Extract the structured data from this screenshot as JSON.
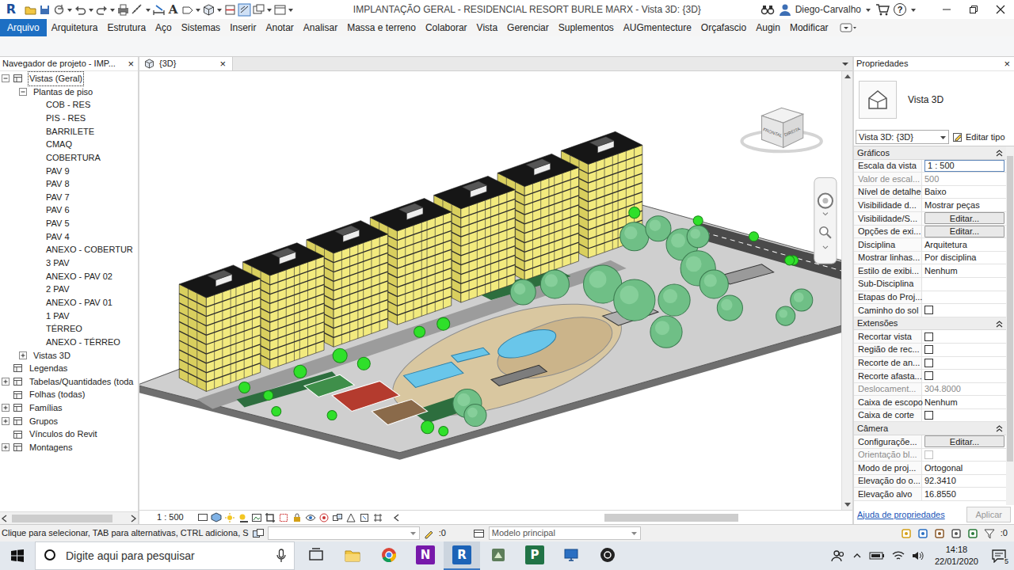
{
  "window": {
    "app_glyph": "R",
    "text_tool_glyph": "A",
    "title": "IMPLANTAÇÃO GERAL - RESIDENCIAL RESORT BURLE MARX - Vista 3D: {3D}",
    "user": "Diego-Carvalho",
    "help": "?"
  },
  "ribbon": {
    "tabs": [
      {
        "label": "Arquivo",
        "kind": "app",
        "selected": false
      },
      {
        "label": "Arquitetura",
        "kind": "tab",
        "selected": false
      },
      {
        "label": "Estrutura",
        "kind": "tab",
        "selected": false
      },
      {
        "label": "Aço",
        "kind": "tab",
        "selected": false
      },
      {
        "label": "Sistemas",
        "kind": "tab",
        "selected": false
      },
      {
        "label": "Inserir",
        "kind": "tab",
        "selected": false
      },
      {
        "label": "Anotar",
        "kind": "tab",
        "selected": false
      },
      {
        "label": "Analisar",
        "kind": "tab",
        "selected": false
      },
      {
        "label": "Massa e terreno",
        "kind": "tab",
        "selected": false
      },
      {
        "label": "Colaborar",
        "kind": "tab",
        "selected": false
      },
      {
        "label": "Vista",
        "kind": "tab",
        "selected": false
      },
      {
        "label": "Gerenciar",
        "kind": "tab",
        "selected": false
      },
      {
        "label": "Suplementos",
        "kind": "tab",
        "selected": false
      },
      {
        "label": "AUGmentecture",
        "kind": "tab",
        "selected": false
      },
      {
        "label": "Orçafascio",
        "kind": "tab",
        "selected": false
      },
      {
        "label": "Augin",
        "kind": "tab",
        "selected": false
      },
      {
        "label": "Modificar",
        "kind": "tab",
        "selected": false
      }
    ]
  },
  "browser": {
    "title": "Navegador de projeto - IMP...",
    "close": "×",
    "items": [
      {
        "label": "Vistas (Geral)",
        "level": 0,
        "has_children": true,
        "expanded": true,
        "selected": true
      },
      {
        "label": "Plantas de piso",
        "level": 1,
        "has_children": true,
        "expanded": true,
        "selected": false
      },
      {
        "label": "COB - RES",
        "level": 2,
        "has_children": false,
        "expanded": false,
        "selected": false
      },
      {
        "label": "PIS - RES",
        "level": 2,
        "has_children": false,
        "expanded": false,
        "selected": false
      },
      {
        "label": "BARRILETE",
        "level": 2,
        "has_children": false,
        "expanded": false,
        "selected": false
      },
      {
        "label": "CMAQ",
        "level": 2,
        "has_children": false,
        "expanded": false,
        "selected": false
      },
      {
        "label": "COBERTURA",
        "level": 2,
        "has_children": false,
        "expanded": false,
        "selected": false
      },
      {
        "label": "PAV 9",
        "level": 2,
        "has_children": false,
        "expanded": false,
        "selected": false
      },
      {
        "label": "PAV 8",
        "level": 2,
        "has_children": false,
        "expanded": false,
        "selected": false
      },
      {
        "label": "PAV 7",
        "level": 2,
        "has_children": false,
        "expanded": false,
        "selected": false
      },
      {
        "label": "PAV 6",
        "level": 2,
        "has_children": false,
        "expanded": false,
        "selected": false
      },
      {
        "label": "PAV 5",
        "level": 2,
        "has_children": false,
        "expanded": false,
        "selected": false
      },
      {
        "label": "PAV 4",
        "level": 2,
        "has_children": false,
        "expanded": false,
        "selected": false
      },
      {
        "label": "ANEXO - COBERTUR",
        "level": 2,
        "has_children": false,
        "expanded": false,
        "selected": false
      },
      {
        "label": "3 PAV",
        "level": 2,
        "has_children": false,
        "expanded": false,
        "selected": false
      },
      {
        "label": "ANEXO - PAV 02",
        "level": 2,
        "has_children": false,
        "expanded": false,
        "selected": false
      },
      {
        "label": "2 PAV",
        "level": 2,
        "has_children": false,
        "expanded": false,
        "selected": false
      },
      {
        "label": "ANEXO - PAV 01",
        "level": 2,
        "has_children": false,
        "expanded": false,
        "selected": false
      },
      {
        "label": "1 PAV",
        "level": 2,
        "has_children": false,
        "expanded": false,
        "selected": false
      },
      {
        "label": "TÉRREO",
        "level": 2,
        "has_children": false,
        "expanded": false,
        "selected": false
      },
      {
        "label": "ANEXO - TÉRREO",
        "level": 2,
        "has_children": false,
        "expanded": false,
        "selected": false
      },
      {
        "label": "Vistas 3D",
        "level": 1,
        "has_children": true,
        "expanded": false,
        "selected": false
      },
      {
        "label": "Legendas",
        "level": 0,
        "has_children": false,
        "expanded": false,
        "selected": false
      },
      {
        "label": "Tabelas/Quantidades (toda",
        "level": 0,
        "has_children": true,
        "expanded": false,
        "selected": false
      },
      {
        "label": "Folhas (todas)",
        "level": 0,
        "has_children": false,
        "expanded": false,
        "selected": false
      },
      {
        "label": "Famílias",
        "level": 0,
        "has_children": true,
        "expanded": false,
        "selected": false
      },
      {
        "label": "Grupos",
        "level": 0,
        "has_children": true,
        "expanded": false,
        "selected": false
      },
      {
        "label": "Vínculos do Revit",
        "level": 0,
        "has_children": false,
        "expanded": false,
        "selected": false
      },
      {
        "label": "Montagens",
        "level": 0,
        "has_children": true,
        "expanded": false,
        "selected": false
      }
    ]
  },
  "view": {
    "tab": "{3D}",
    "close": "×",
    "scale": "1 : 500",
    "viewcube": [
      "FRONTAL",
      "DIREITA"
    ]
  },
  "properties": {
    "title": "Propriedades",
    "close": "×",
    "type_name": "Vista 3D",
    "instance": "Vista 3D: {3D}",
    "edit_type": "Editar tipo",
    "sections": [
      {
        "title": "Gráficos",
        "expanded": true,
        "rows": [
          {
            "label": "Escala da vista",
            "kind": "input",
            "value": "1 : 500",
            "disabled": false
          },
          {
            "label": "Valor de escal...",
            "kind": "text",
            "value": "500",
            "disabled": true
          },
          {
            "label": "Nível de detalhe",
            "kind": "text",
            "value": "Baixo",
            "disabled": false
          },
          {
            "label": "Visibilidade d...",
            "kind": "text",
            "value": "Mostrar peças",
            "disabled": false
          },
          {
            "label": "Visibilidade/S...",
            "kind": "button",
            "value": "Editar...",
            "disabled": false
          },
          {
            "label": "Opções de exi...",
            "kind": "button",
            "value": "Editar...",
            "disabled": false
          },
          {
            "label": "Disciplina",
            "kind": "text",
            "value": "Arquitetura",
            "disabled": false
          },
          {
            "label": "Mostrar linhas...",
            "kind": "text",
            "value": "Por disciplina",
            "disabled": false
          },
          {
            "label": "Estilo de exibi...",
            "kind": "text",
            "value": "Nenhum",
            "disabled": false
          },
          {
            "label": "Sub-Disciplina",
            "kind": "empty",
            "disabled": false
          },
          {
            "label": "Etapas do Proj...",
            "kind": "empty",
            "disabled": false
          },
          {
            "label": "Caminho do sol",
            "kind": "check",
            "checked": false,
            "disabled": false
          }
        ]
      },
      {
        "title": "Extensões",
        "expanded": true,
        "rows": [
          {
            "label": "Recortar vista",
            "kind": "check",
            "checked": false,
            "disabled": false
          },
          {
            "label": "Região de rec...",
            "kind": "check",
            "checked": false,
            "disabled": false
          },
          {
            "label": "Recorte de an...",
            "kind": "check",
            "checked": false,
            "disabled": false
          },
          {
            "label": "Recorte afasta...",
            "kind": "check",
            "checked": false,
            "disabled": false
          },
          {
            "label": "Deslocament...",
            "kind": "text",
            "value": "304.8000",
            "disabled": true
          },
          {
            "label": "Caixa de escopo",
            "kind": "text",
            "value": "Nenhum",
            "disabled": false
          },
          {
            "label": "Caixa de corte",
            "kind": "check",
            "checked": false,
            "disabled": false
          }
        ]
      },
      {
        "title": "Câmera",
        "expanded": true,
        "rows": [
          {
            "label": "Configuraçõe...",
            "kind": "button",
            "value": "Editar...",
            "disabled": false
          },
          {
            "label": "Orientação bl...",
            "kind": "check",
            "checked": false,
            "disabled": true
          },
          {
            "label": "Modo de proj...",
            "kind": "text",
            "value": "Ortogonal",
            "disabled": false
          },
          {
            "label": "Elevação do o...",
            "kind": "text",
            "value": "92.3410",
            "disabled": false
          },
          {
            "label": "Elevação alvo",
            "kind": "text",
            "value": "16.8550",
            "disabled": false
          }
        ]
      }
    ],
    "help": "Ajuda de propriedades",
    "apply": "Aplicar",
    "apply_disabled": true
  },
  "status_bar": {
    "hint": "Clique para selecionar, TAB para alternativas, CTRL adiciona, S",
    "selection_count": ":0",
    "workset": "Modelo principal",
    "filter_count": ":0"
  },
  "taskbar": {
    "search_placeholder": "Digite aqui para pesquisar",
    "apps": [
      {
        "kind": "taskview",
        "selected": false
      },
      {
        "kind": "explorer",
        "selected": false
      },
      {
        "kind": "chrome",
        "selected": false
      },
      {
        "kind": "onenote",
        "glyph": "N",
        "selected": false
      },
      {
        "kind": "revit",
        "glyph": "R",
        "selected": true
      },
      {
        "kind": "navisworks",
        "selected": false
      },
      {
        "kind": "project",
        "glyph": "P",
        "selected": false
      },
      {
        "kind": "remote",
        "selected": false
      },
      {
        "kind": "obs",
        "selected": false
      }
    ],
    "time": "14:18",
    "date": "22/01/2020",
    "notifications": "5"
  }
}
